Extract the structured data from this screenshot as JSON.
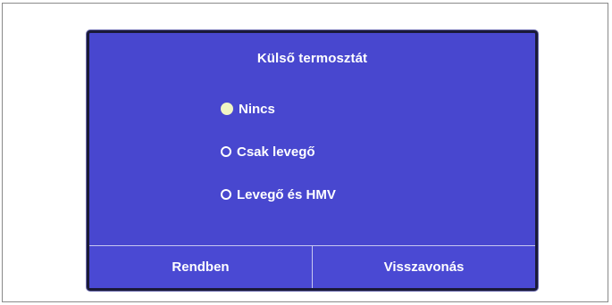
{
  "dialog": {
    "title": "Külső termosztát",
    "options": [
      {
        "label": "Nincs",
        "selected": true
      },
      {
        "label": "Csak levegő",
        "selected": false
      },
      {
        "label": "Levegő és HMV",
        "selected": false
      }
    ],
    "ok_label": "Rendben",
    "cancel_label": "Visszavonás"
  },
  "colors": {
    "panel_bg": "#4847cf",
    "panel_border": "#1a1a38",
    "text": "#ffffff",
    "selected_radio": "#f1f5c4"
  }
}
